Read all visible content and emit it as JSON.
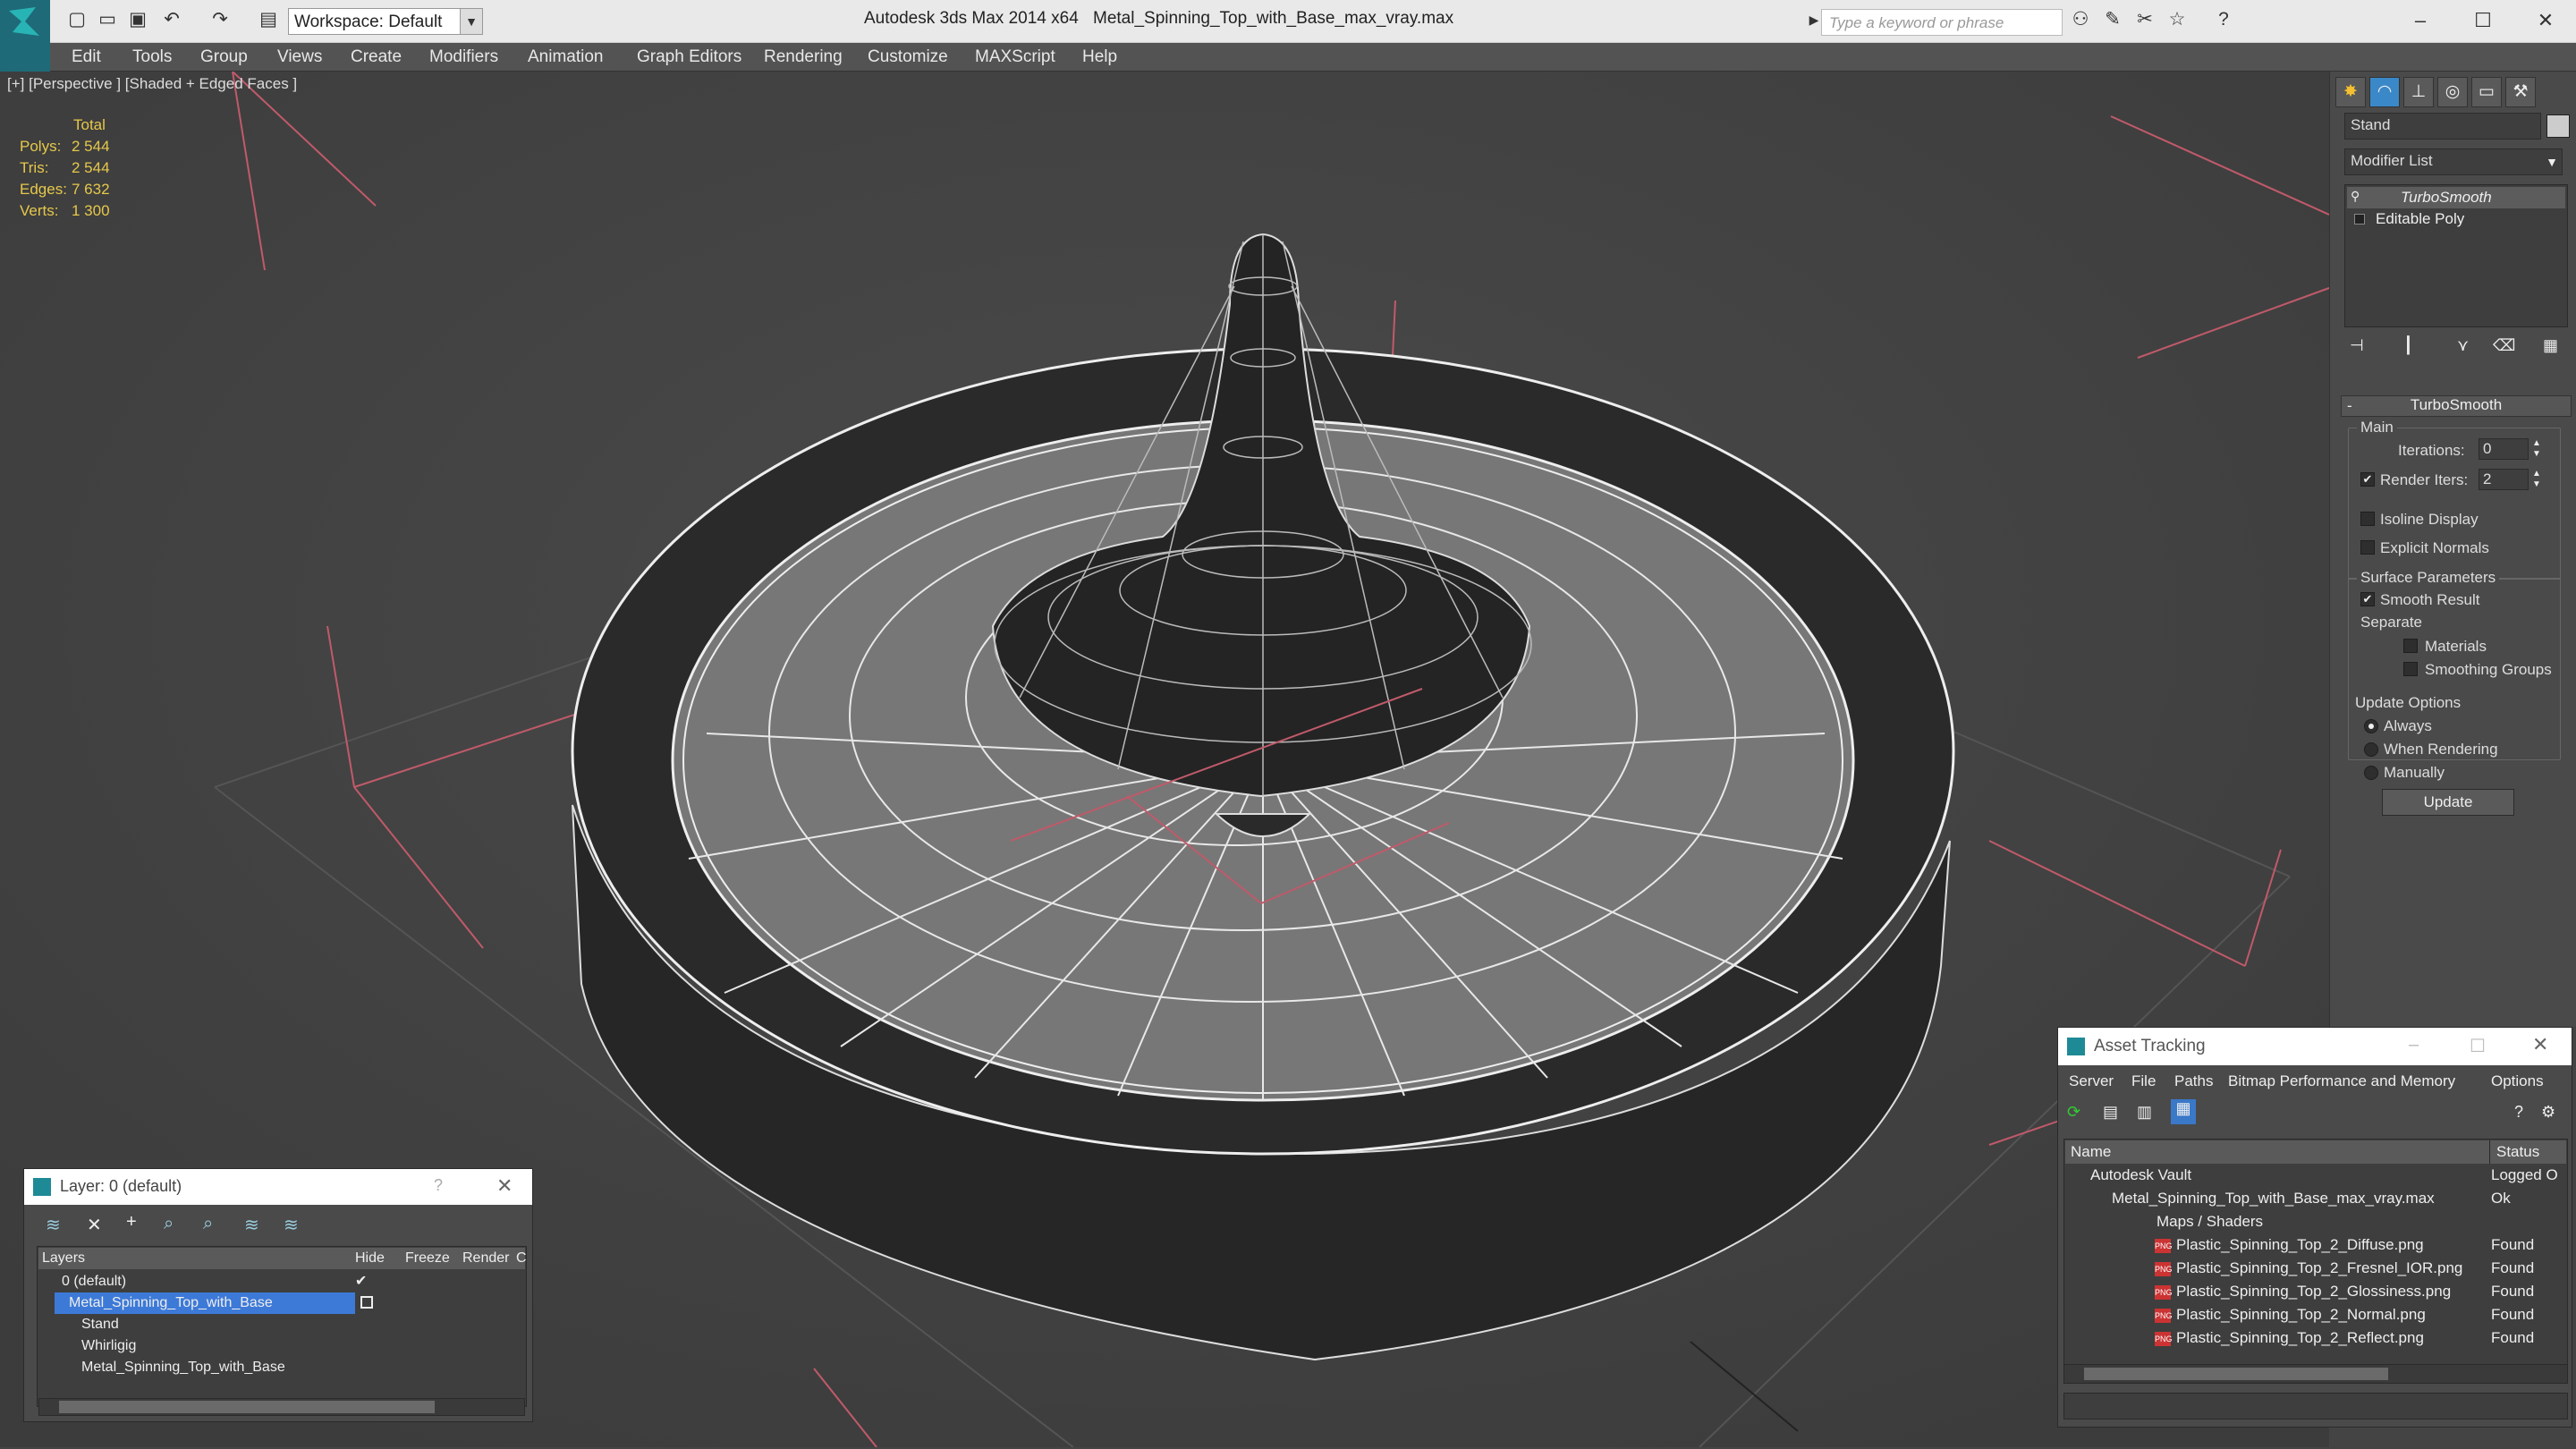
{
  "titlebar": {
    "app_title": "Autodesk 3ds Max  2014 x64",
    "file_name": "Metal_Spinning_Top_with_Base_max_vray.max",
    "workspace": "Workspace: Default",
    "search_placeholder": "Type a keyword or phrase"
  },
  "menu": [
    "Edit",
    "Tools",
    "Group",
    "Views",
    "Create",
    "Modifiers",
    "Animation",
    "Graph Editors",
    "Rendering",
    "Customize",
    "MAXScript",
    "Help"
  ],
  "viewport": {
    "label": "[+] [Perspective ] [Shaded + Edged Faces ]",
    "stats_header": "Total",
    "stats": [
      {
        "k": "Polys:",
        "v": "2 544"
      },
      {
        "k": "Tris:",
        "v": "2 544"
      },
      {
        "k": "Edges:",
        "v": "7 632"
      },
      {
        "k": "Verts:",
        "v": "1 300"
      }
    ]
  },
  "command_panel": {
    "object_name": "Stand",
    "modifier_list": "Modifier List",
    "stack": [
      "TurboSmooth",
      "Editable Poly"
    ],
    "rollout_title": "TurboSmooth",
    "main_group": "Main",
    "iterations_label": "Iterations:",
    "iterations_value": "0",
    "render_iters_label": "Render Iters:",
    "render_iters_value": "2",
    "isoline_display": "Isoline Display",
    "explicit_normals": "Explicit Normals",
    "surface_params": "Surface Parameters",
    "smooth_result": "Smooth Result",
    "separate": "Separate",
    "materials": "Materials",
    "smoothing_groups": "Smoothing Groups",
    "update_options": "Update Options",
    "always": "Always",
    "when_rendering": "When Rendering",
    "manually": "Manually",
    "update_button": "Update"
  },
  "layer_dialog": {
    "title": "Layer: 0 (default)",
    "columns": [
      "Layers",
      "Hide",
      "Freeze",
      "Render",
      "C"
    ],
    "rows": [
      "0 (default)",
      "Metal_Spinning_Top_with_Base",
      "Stand",
      "Whirligig",
      "Metal_Spinning_Top_with_Base"
    ]
  },
  "asset_dialog": {
    "title": "Asset Tracking",
    "menu": [
      "Server",
      "File",
      "Paths",
      "Bitmap Performance and Memory",
      "Options"
    ],
    "columns": [
      "Name",
      "Status"
    ],
    "rows": [
      {
        "name": "Autodesk Vault",
        "status": "Logged O"
      },
      {
        "name": "Metal_Spinning_Top_with_Base_max_vray.max",
        "status": "Ok"
      },
      {
        "name": "Maps / Shaders",
        "status": ""
      },
      {
        "name": "Plastic_Spinning_Top_2_Diffuse.png",
        "status": "Found"
      },
      {
        "name": "Plastic_Spinning_Top_2_Fresnel_IOR.png",
        "status": "Found"
      },
      {
        "name": "Plastic_Spinning_Top_2_Glossiness.png",
        "status": "Found"
      },
      {
        "name": "Plastic_Spinning_Top_2_Normal.png",
        "status": "Found"
      },
      {
        "name": "Plastic_Spinning_Top_2_Reflect.png",
        "status": "Found"
      }
    ]
  }
}
